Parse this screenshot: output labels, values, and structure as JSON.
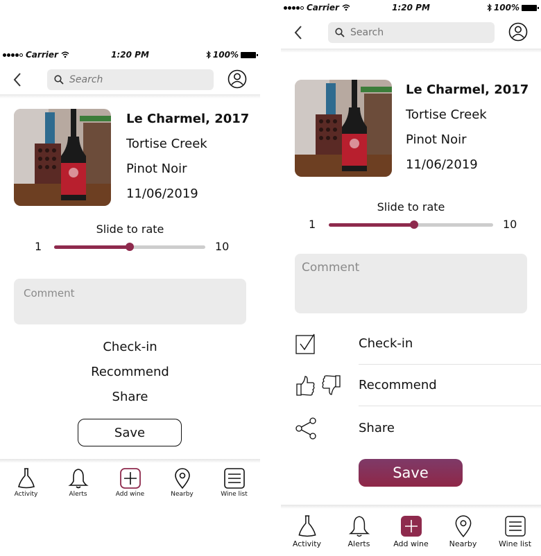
{
  "status_bar": {
    "carrier": "Carrier",
    "time": "1:20 PM",
    "battery": "100%"
  },
  "search": {
    "placeholder": "Search"
  },
  "wine": {
    "name": "Le Charmel, 2017",
    "winery": "Tortise Creek",
    "varietal": "Pinot Noir",
    "date": "11/06/2019"
  },
  "rating": {
    "label": "Slide to rate",
    "min_label": "1",
    "max_label": "10",
    "left_value_fraction": 0.5,
    "right_value_fraction": 0.52
  },
  "comment": {
    "placeholder": "Comment"
  },
  "actions": {
    "checkin": "Check-in",
    "recommend": "Recommend",
    "share": "Share"
  },
  "save_label": "Save",
  "tabbar": {
    "items": [
      "Activity",
      "Alerts",
      "Add wine",
      "Nearby",
      "Wine list"
    ]
  },
  "colors": {
    "accent": "#8e2a4d",
    "track": "#cdcdcd",
    "field_bg": "#ebebeb"
  }
}
